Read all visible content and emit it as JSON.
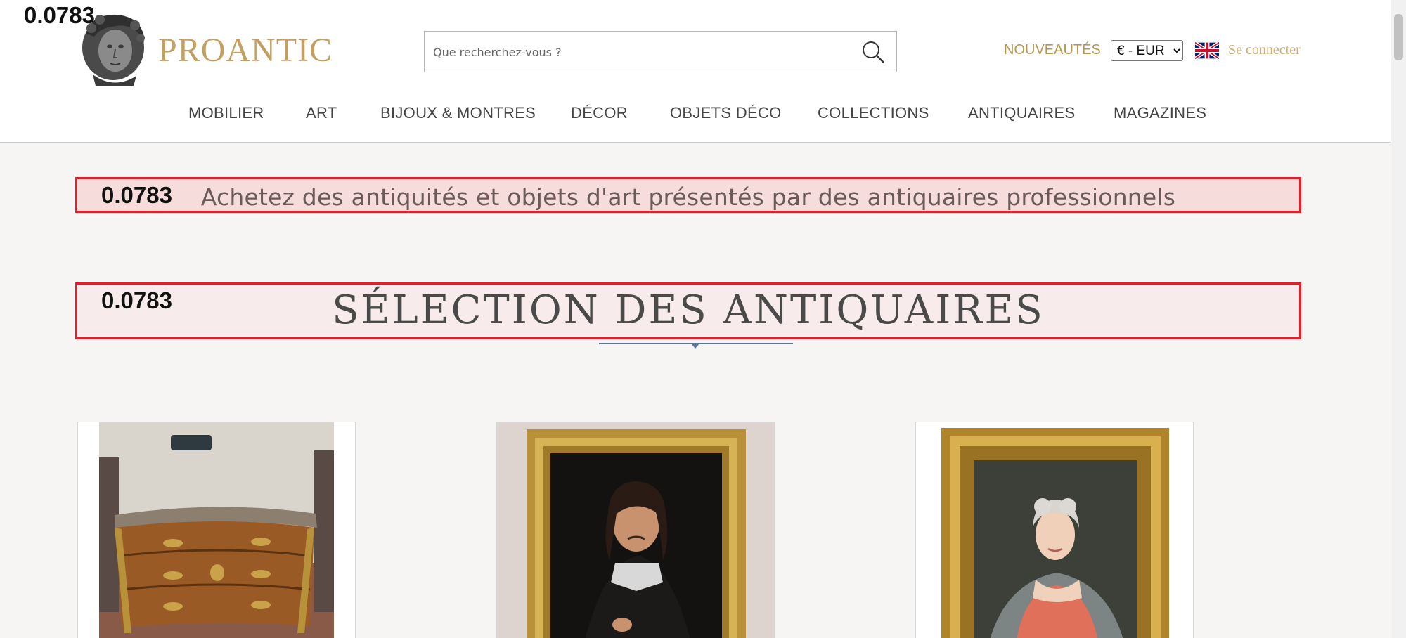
{
  "overlay_score": "0.0783",
  "brand": {
    "name": "PROANTIC",
    "color": "#c2a064"
  },
  "search": {
    "placeholder": "Que recherchez-vous ?"
  },
  "header_links": {
    "new_label": "NOUVEAUTÉS",
    "currency_selected": "€ - EUR",
    "language_flag": "uk-flag-icon",
    "login_label": "Se connecter"
  },
  "nav": {
    "items": [
      {
        "label": "MOBILIER"
      },
      {
        "label": "ART"
      },
      {
        "label": "BIJOUX & MONTRES"
      },
      {
        "label": "DÉCOR"
      },
      {
        "label": "OBJETS DÉCO"
      },
      {
        "label": "COLLECTIONS"
      },
      {
        "label": "ANTIQUAIRES"
      },
      {
        "label": "MAGAZINES"
      }
    ]
  },
  "banner_tagline": {
    "score": "0.0783",
    "text": "Achetez des antiquités et objets d'art présentés par des antiquaires professionnels"
  },
  "banner_section": {
    "score": "0.0783",
    "title": "SÉLECTION DES ANTIQUAIRES"
  },
  "products": [
    {
      "image": "commode-image"
    },
    {
      "image": "portrait-man-image"
    },
    {
      "image": "portrait-woman-image"
    }
  ],
  "colors": {
    "highlight_border": "#e0202a",
    "accent_gold": "#b8974f",
    "underline_blue": "#5a7595"
  }
}
